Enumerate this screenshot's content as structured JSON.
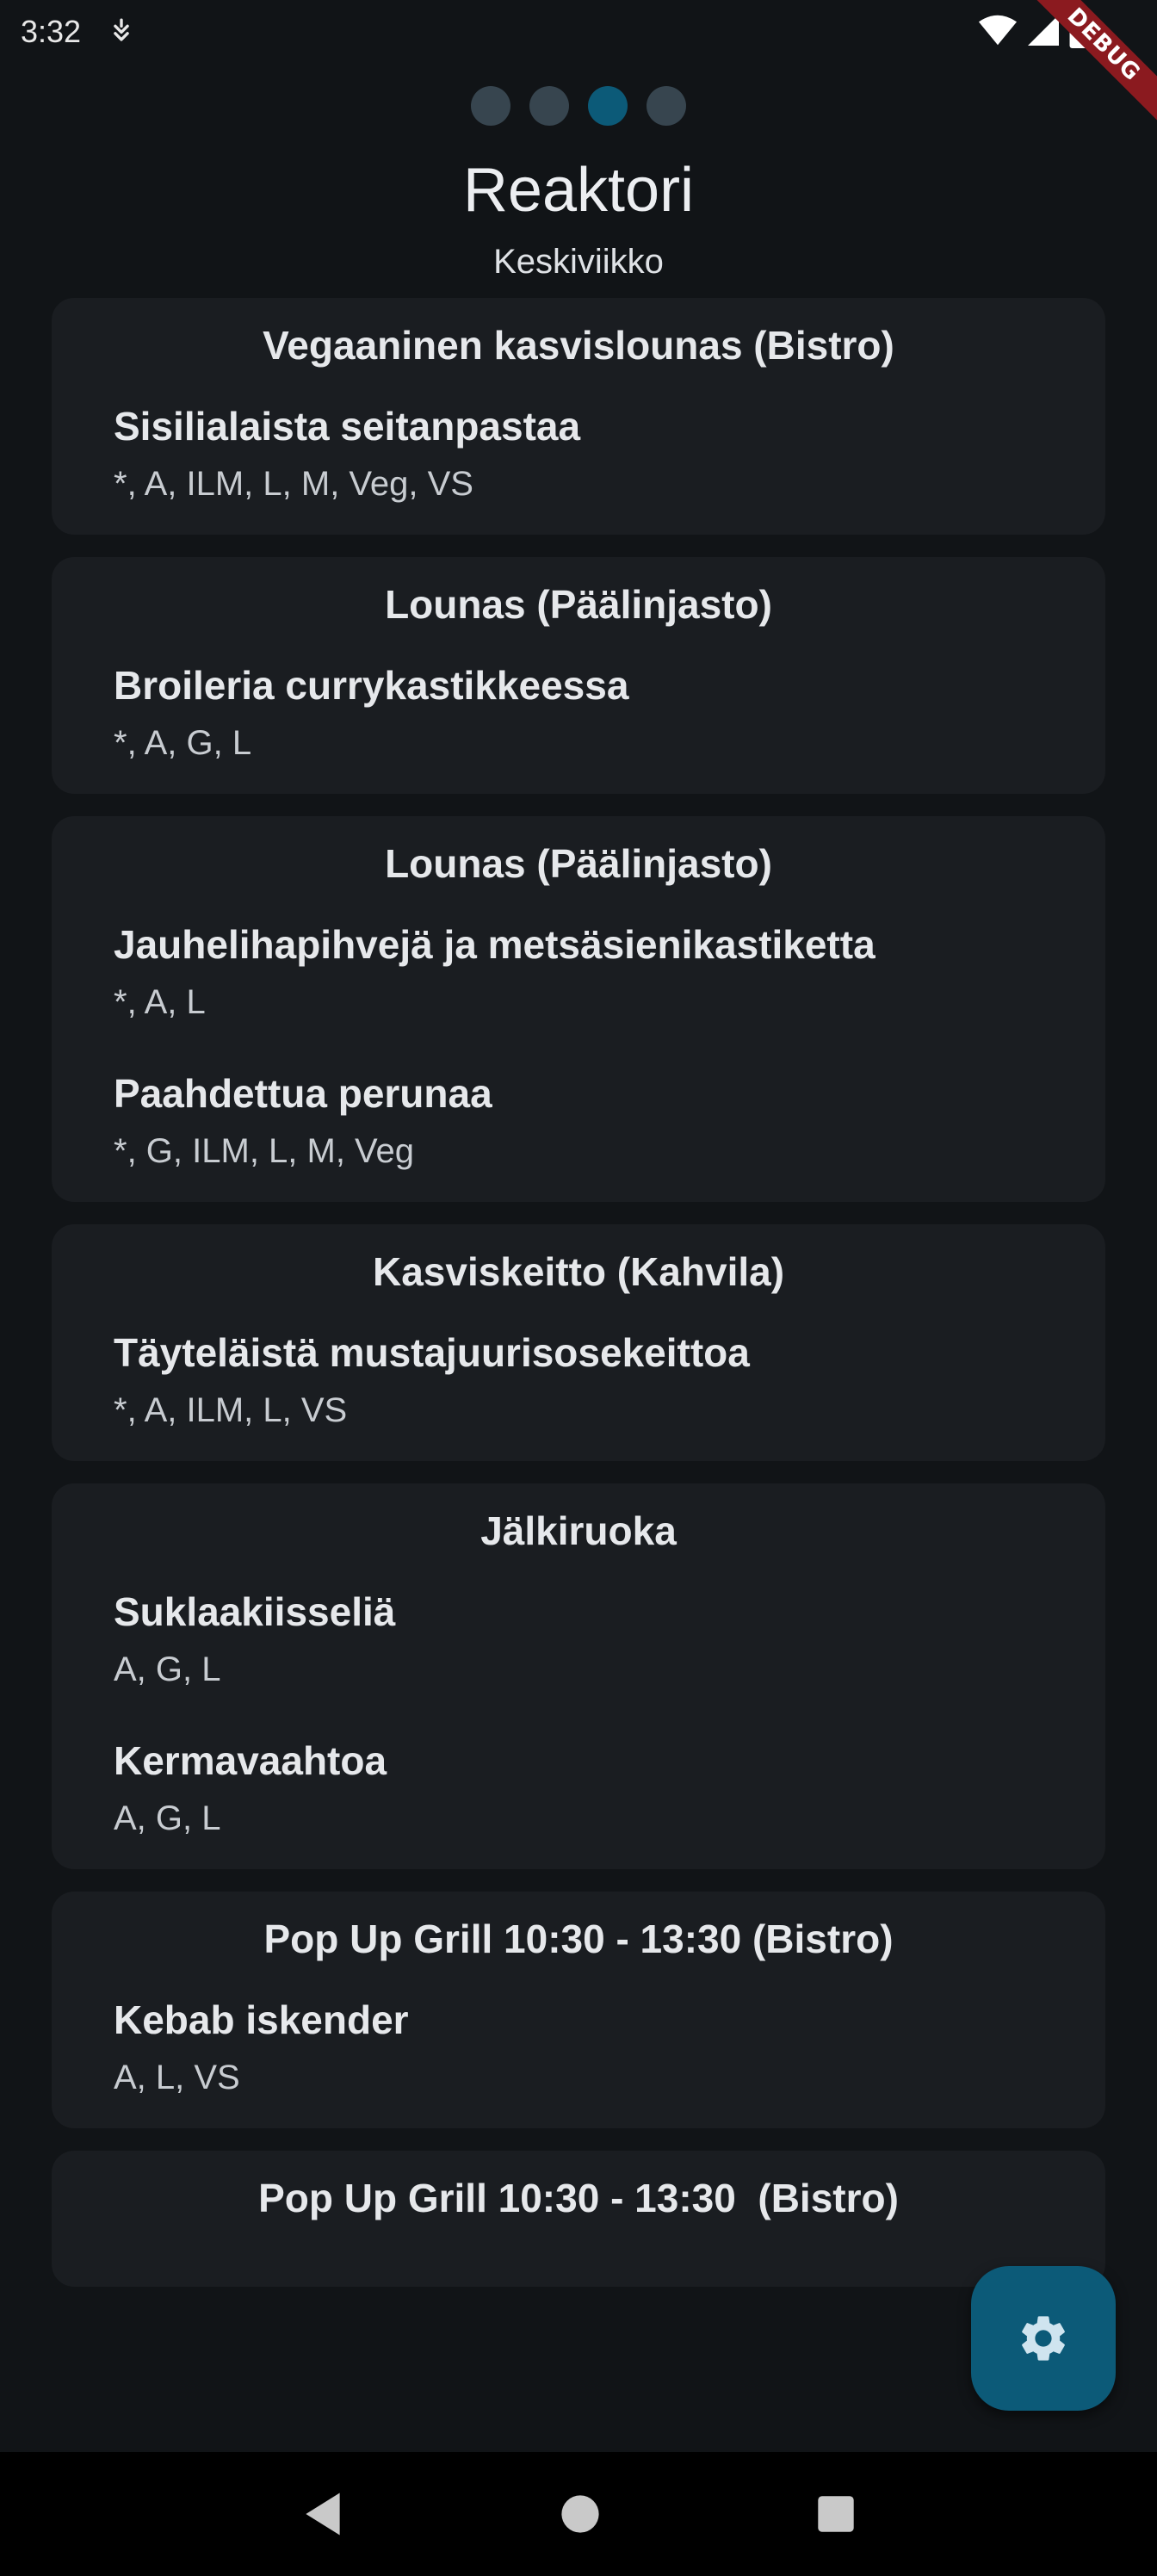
{
  "status_bar": {
    "time": "3:32"
  },
  "debug_label": "DEBUG",
  "pager": {
    "count": 4,
    "active": 2
  },
  "header": {
    "title": "Reaktori",
    "subtitle": "Keskiviikko"
  },
  "cards": [
    {
      "title": "Vegaaninen kasvislounas (Bistro)",
      "items": [
        {
          "name": "Sisilialaista seitanpastaa",
          "diet": "*, A, ILM, L, M, Veg, VS"
        }
      ]
    },
    {
      "title": "Lounas (Päälinjasto)",
      "items": [
        {
          "name": "Broileria currykastikkeessa",
          "diet": "*, A, G, L"
        }
      ]
    },
    {
      "title": "Lounas (Päälinjasto)",
      "items": [
        {
          "name": "Jauhelihapihvejä ja metsäsienikastiketta",
          "diet": "*, A, L"
        },
        {
          "name": "Paahdettua perunaa",
          "diet": "*, G, ILM, L, M, Veg"
        }
      ]
    },
    {
      "title": "Kasviskeitto (Kahvila)",
      "items": [
        {
          "name": "Täyteläistä mustajuurisosekeittoa",
          "diet": "*, A, ILM, L, VS"
        }
      ]
    },
    {
      "title": "Jälkiruoka",
      "items": [
        {
          "name": "Suklaakiisseliä",
          "diet": "A, G, L"
        },
        {
          "name": "Kermavaahtoa",
          "diet": "A, G, L"
        }
      ]
    },
    {
      "title": "Pop Up Grill 10:30 - 13:30 (Bistro)",
      "items": [
        {
          "name": "Kebab iskender",
          "diet": "A, L, VS"
        }
      ]
    },
    {
      "title": "Pop Up Grill 10:30 - 13:30  (Bistro)",
      "items": []
    }
  ],
  "fab": {
    "icon": "gear-icon"
  },
  "colors": {
    "background": "#111417",
    "card": "#1a1d21",
    "accent": "#0c5a78",
    "dot_inactive": "#37454f"
  }
}
